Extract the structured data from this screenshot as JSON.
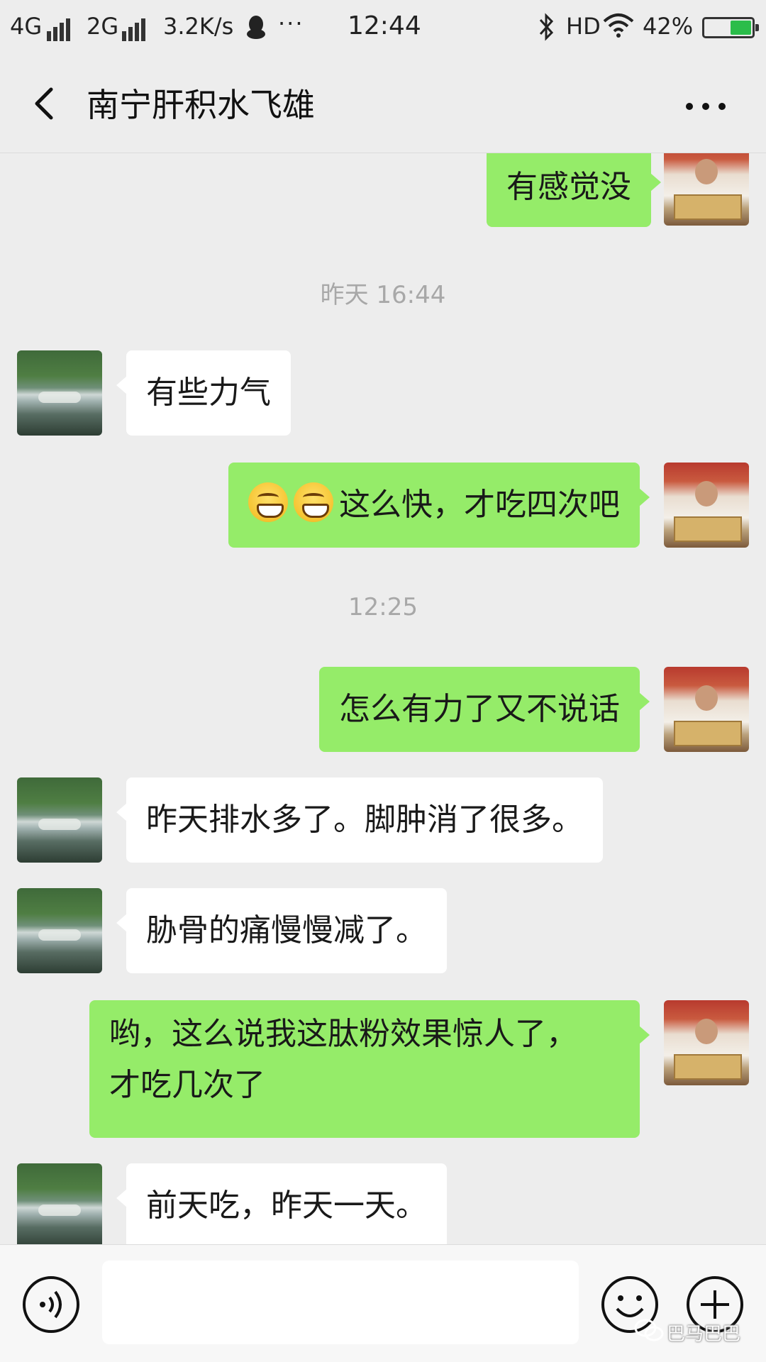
{
  "status_bar": {
    "network_1": "4G",
    "network_2": "2G",
    "speed": "3.2K/s",
    "more": "···",
    "time": "12:44",
    "hd": "HD",
    "battery": "42%",
    "battery_level": 0.42,
    "icons": [
      "signal-icon",
      "qq-icon",
      "bluetooth-icon",
      "wifi-icon",
      "battery-icon"
    ]
  },
  "header": {
    "title": "南宁肝积水飞雄",
    "icons": [
      "back-icon",
      "more-icon"
    ]
  },
  "messages": [
    {
      "side": "out",
      "text": "有感觉没"
    },
    {
      "type": "time",
      "text": "昨天 16:44"
    },
    {
      "side": "in",
      "text": "有些力气"
    },
    {
      "side": "out",
      "text": "这么快，才吃四次吧",
      "emoji": [
        "grin-emoji",
        "grin-emoji"
      ]
    },
    {
      "type": "time",
      "text": "12:25"
    },
    {
      "side": "out",
      "text": "怎么有力了又不说话"
    },
    {
      "side": "in",
      "text": "昨天排水多了。脚肿消了很多。"
    },
    {
      "side": "in",
      "text": "胁骨的痛慢慢减了。"
    },
    {
      "side": "out",
      "lines": [
        "哟，这么说我这肽粉效果惊人了，",
        "才吃几次了"
      ]
    },
    {
      "side": "in",
      "text": "前天吃，昨天一天。"
    }
  ],
  "input_bar": {
    "value": "",
    "icons": [
      "voice-icon",
      "emoji-icon",
      "plus-icon"
    ]
  },
  "watermark": "巴马巴巴",
  "colors": {
    "background": "#ededed",
    "outgoing_bubble": "#95ec69",
    "incoming_bubble": "#ffffff",
    "timestamp": "#a8a8a8"
  }
}
